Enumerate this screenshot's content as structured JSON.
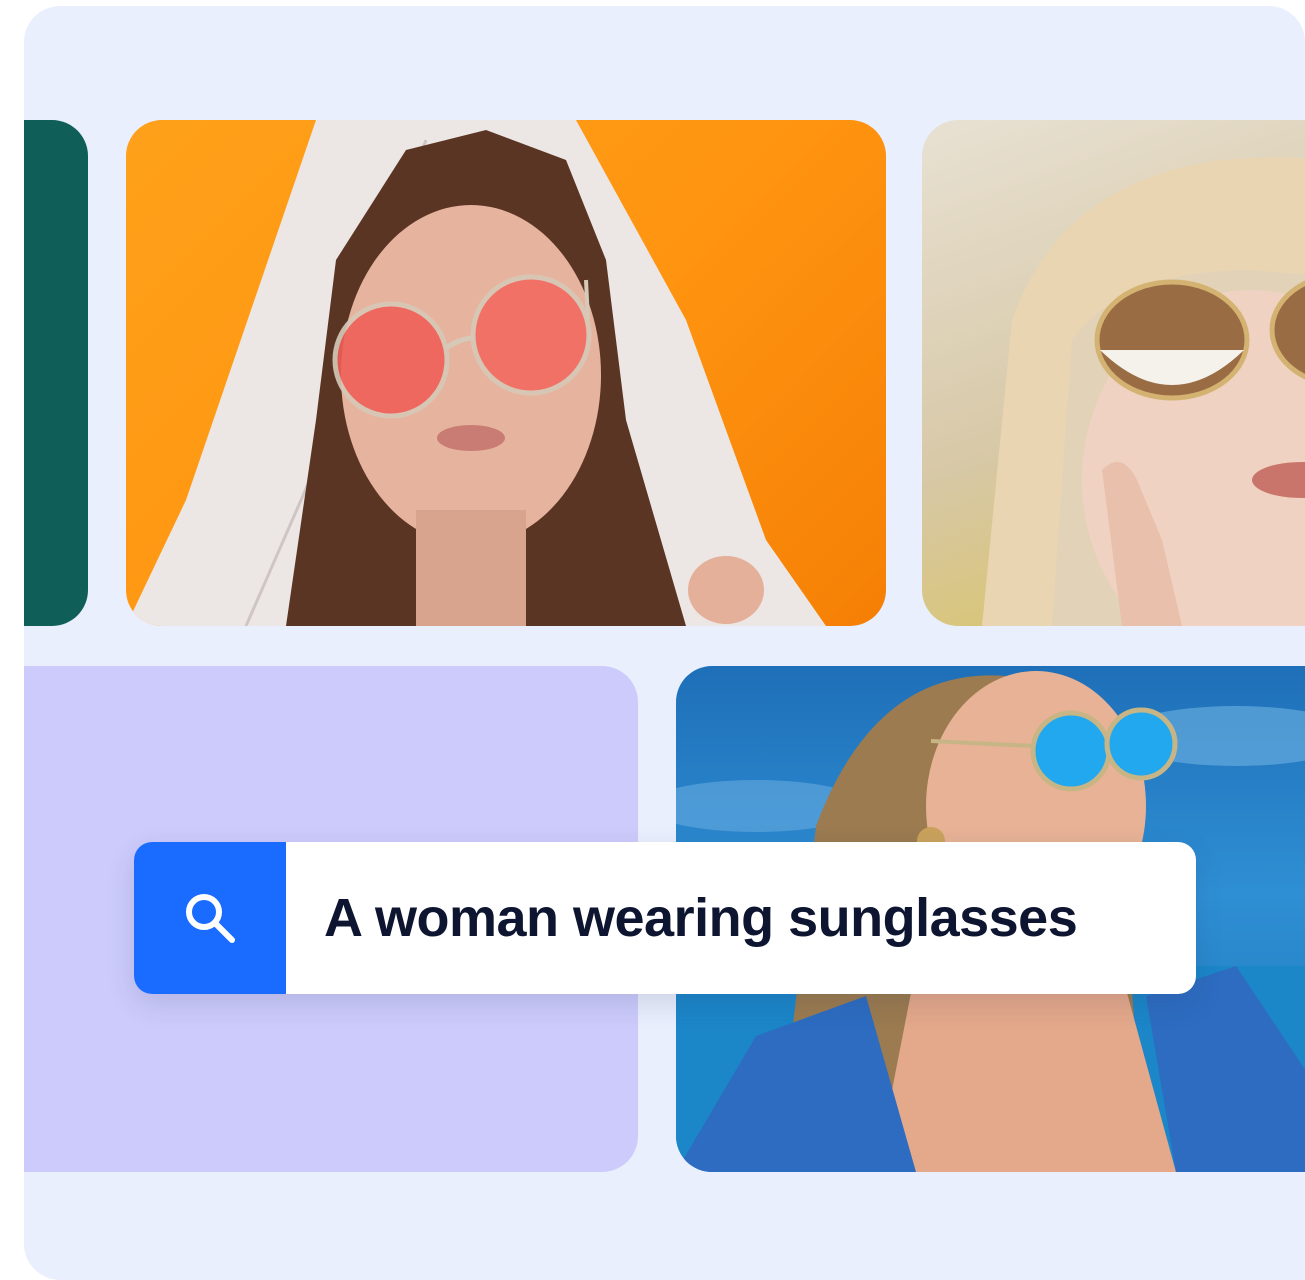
{
  "search": {
    "query": "A woman wearing sunglasses",
    "icon": "search-icon"
  },
  "colors": {
    "background": "#e9effd",
    "accent": "#1a6bff",
    "tile_green": "#0f5e58",
    "tile_lavender": "#cccbfb",
    "tile_orange": "#ff9a12",
    "text": "#0d1530"
  },
  "gallery": {
    "images": [
      {
        "subject": "woman-red-round-sunglasses",
        "background": "orange"
      },
      {
        "subject": "woman-gold-aviator-sunglasses-beige-hat",
        "background": "beige"
      },
      {
        "subject": "woman-blue-mirrored-sunglasses",
        "background": "blue-sky"
      }
    ]
  }
}
